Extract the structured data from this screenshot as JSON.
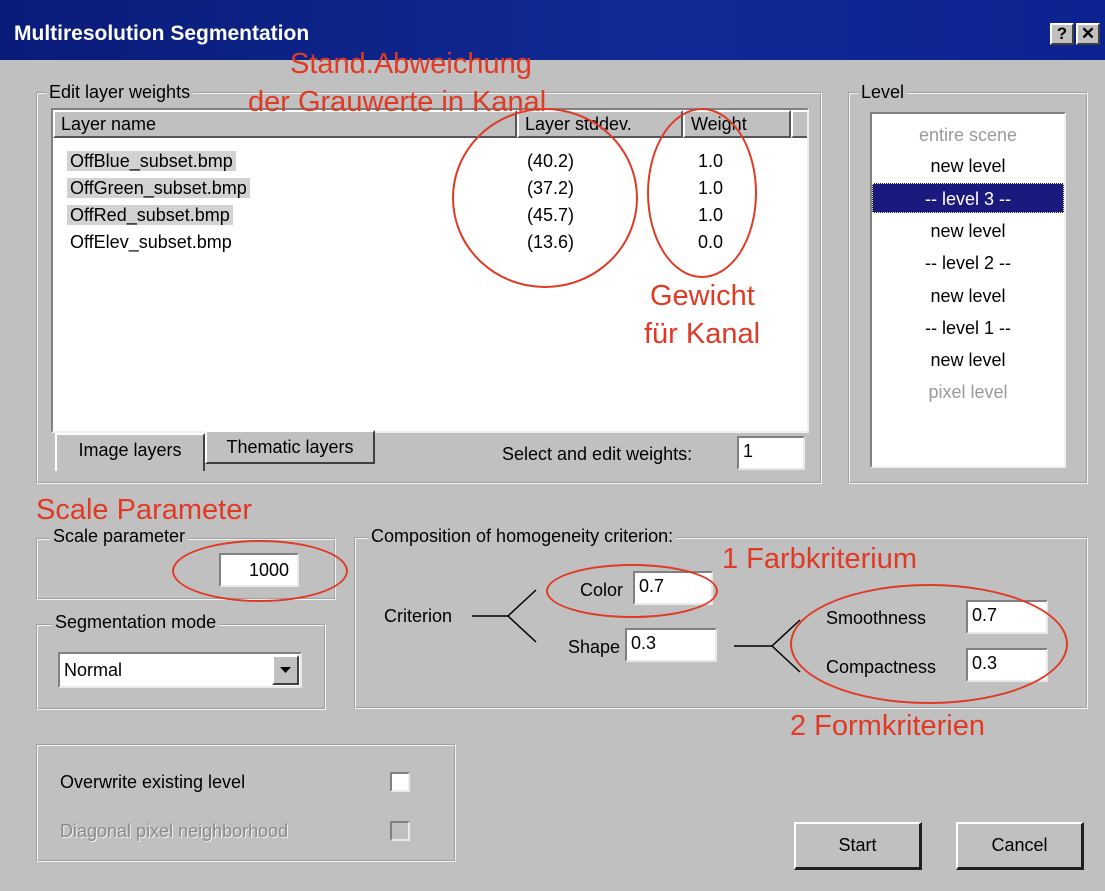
{
  "window": {
    "title": "Multiresolution Segmentation",
    "help_label": "?",
    "close_label": "✕"
  },
  "layers": {
    "group_label": "Edit layer weights",
    "columns": [
      "Layer name",
      "Layer stddev.",
      "Weight"
    ],
    "rows": [
      {
        "name": "OffBlue_subset.bmp",
        "stddev": "(40.2)",
        "weight": "1.0"
      },
      {
        "name": "OffGreen_subset.bmp",
        "stddev": "(37.2)",
        "weight": "1.0"
      },
      {
        "name": "OffRed_subset.bmp",
        "stddev": "(45.7)",
        "weight": "1.0"
      },
      {
        "name": "OffElev_subset.bmp",
        "stddev": "(13.6)",
        "weight": "0.0"
      }
    ],
    "tabs": [
      "Image layers",
      "Thematic layers"
    ],
    "select_label": "Select and edit weights:",
    "select_value": "1"
  },
  "level": {
    "group_label": "Level",
    "items": [
      "entire scene",
      "new level",
      "-- level 3 --",
      "new level",
      "-- level 2 --",
      "new level",
      "-- level 1 --",
      "new level",
      "pixel level"
    ],
    "selected": "-- level 3 --"
  },
  "scale": {
    "group_label": "Scale parameter",
    "value": "1000"
  },
  "segmentation_mode": {
    "group_label": "Segmentation mode",
    "value": "Normal"
  },
  "homogeneity": {
    "group_label": "Composition of homogeneity criterion:",
    "criterion_label": "Criterion",
    "color_label": "Color",
    "color_value": "0.7",
    "shape_label": "Shape",
    "shape_value": "0.3",
    "smoothness_label": "Smoothness",
    "smoothness_value": "0.7",
    "compactness_label": "Compactness",
    "compactness_value": "0.3"
  },
  "options": {
    "overwrite_label": "Overwrite existing level",
    "diagonal_label": "Diagonal pixel neighborhood"
  },
  "buttons": {
    "start": "Start",
    "cancel": "Cancel"
  },
  "annotations": {
    "stddev_line1": "Stand.Abweichung",
    "stddev_line2": "der Grauwerte in Kanal",
    "weight_line1": "Gewicht",
    "weight_line2": "für Kanal",
    "scale": "Scale Parameter",
    "color": "1 Farbkriterium",
    "shape": "2 Formkriterien"
  },
  "colors": {
    "annotation_red": "#e03a25",
    "title_blue": "#0a1c7a",
    "selection_blue": "#1a1a7e"
  }
}
